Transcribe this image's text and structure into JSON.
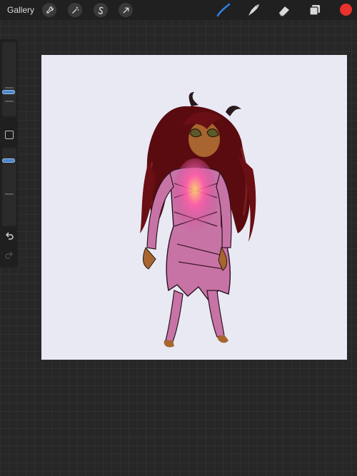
{
  "topbar": {
    "gallery_label": "Gallery",
    "left_tools": [
      "wrench-icon",
      "magic-wand-icon",
      "selection-s-icon",
      "transform-arrow-icon"
    ],
    "right_tools": [
      "brush-icon",
      "smudge-icon",
      "eraser-icon",
      "layers-icon"
    ],
    "current_color": "#e8322b",
    "active_tool_color": "#2f7de1"
  },
  "sidebar": {
    "brush_size_level": 0.3,
    "opacity_level": 0.85
  },
  "canvas": {
    "background": "#e9e9f4",
    "subject": "illustration"
  }
}
